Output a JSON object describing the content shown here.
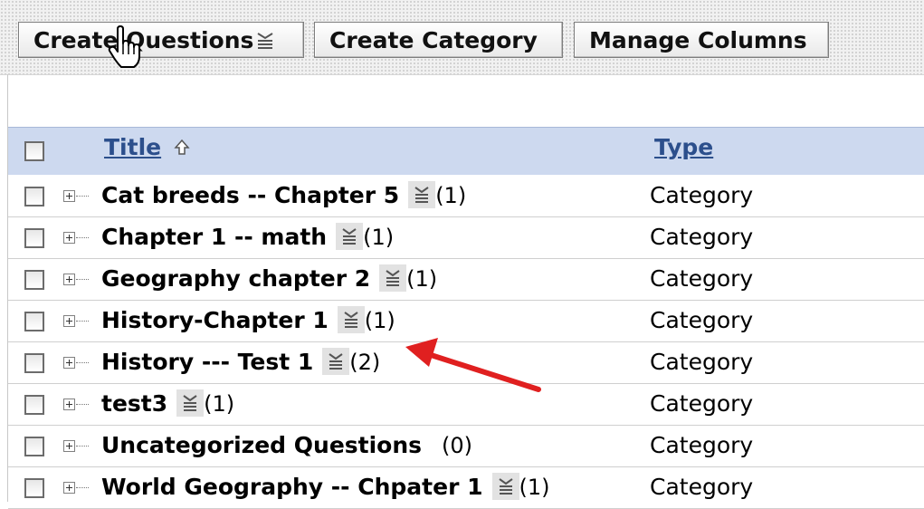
{
  "toolbar": {
    "create_questions_label": "Create Questions",
    "create_category_label": "Create Category",
    "manage_columns_label": "Manage Columns"
  },
  "table": {
    "columns": {
      "title": "Title",
      "type": "Type"
    },
    "rows": [
      {
        "title": "Cat breeds -- Chapter 5",
        "count": "(1)",
        "type": "Category"
      },
      {
        "title": "Chapter 1 -- math",
        "count": "(1)",
        "type": "Category"
      },
      {
        "title": "Geography chapter 2",
        "count": "(1)",
        "type": "Category"
      },
      {
        "title": "History-Chapter 1",
        "count": "(1)",
        "type": "Category"
      },
      {
        "title": "History --- Test 1",
        "count": "(2)",
        "type": "Category"
      },
      {
        "title": "test3",
        "count": "(1)",
        "type": "Category"
      },
      {
        "title": "Uncategorized Questions",
        "count": "(0)",
        "type": "Category"
      },
      {
        "title": "World Geography -- Chpater 1",
        "count": "(1)",
        "type": "Category"
      }
    ]
  },
  "colors": {
    "header_bg": "#cdd9ef",
    "link": "#2c4f8c",
    "annotation_arrow": "#e02020"
  }
}
